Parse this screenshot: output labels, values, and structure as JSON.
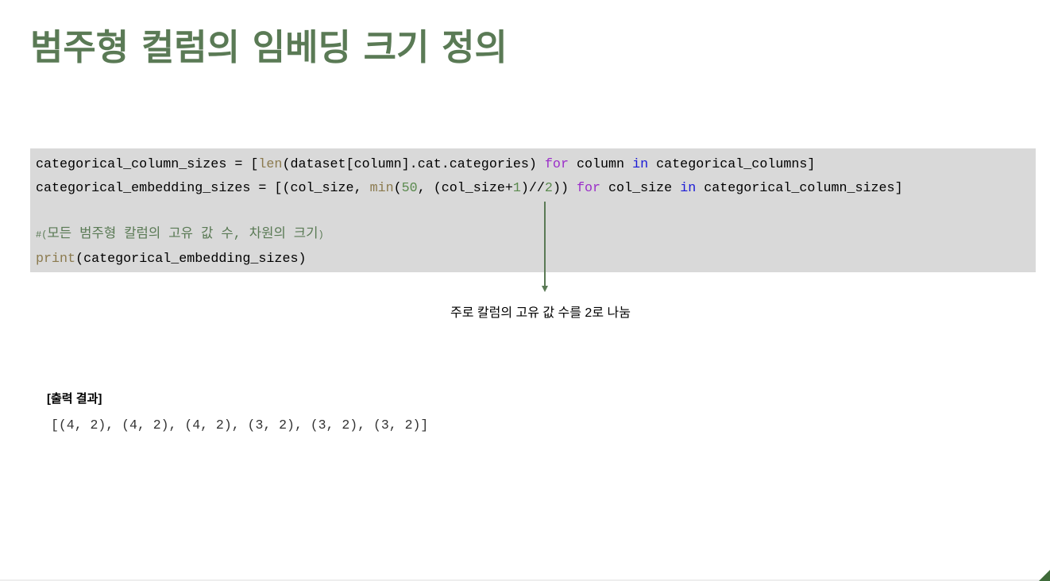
{
  "slide": {
    "title": "범주형 컬럼의 임베딩 크기 정의"
  },
  "code": {
    "line1": {
      "a": "categorical_column_sizes = [",
      "fn_len": "len",
      "b": "(dataset[column].cat.categories) ",
      "kw_for": "for",
      "c": " column ",
      "kw_in": "in",
      "d": " categorical_columns]"
    },
    "line2": {
      "a": "categorical_embedding_sizes = [(col_size, ",
      "fn_min": "min",
      "b": "(",
      "num_50": "50",
      "c": ", (col_size+",
      "num_1": "1",
      "d": ")//",
      "num_2": "2",
      "e": ")) ",
      "kw_for": "for",
      "f": " col_size ",
      "kw_in": "in",
      "g": " categorical_column_sizes]"
    },
    "line3": {
      "hash": "#",
      "open": "(",
      "comment": "모든 범주형 칼럼의 고유 값 수, 차원의 크기",
      "close": ")"
    },
    "line4": {
      "fn_print": "print",
      "rest": "(categorical_embedding_sizes)"
    }
  },
  "annotation": {
    "text": "주로 칼럼의 고유 값 수를 2로 나눔"
  },
  "output": {
    "label": "[출력 결과]",
    "value": "[(4, 2), (4, 2), (4, 2), (3, 2), (3, 2), (3, 2)]"
  },
  "colors": {
    "title": "#5a7a55",
    "code_background": "#d9d9d9",
    "keyword_for": "#9b2fc9",
    "keyword_in": "#1a1ad6",
    "builtin": "#8b7a4e",
    "number": "#5a8a4e",
    "comment": "#5a7a55",
    "arrow": "#5a7a55"
  }
}
